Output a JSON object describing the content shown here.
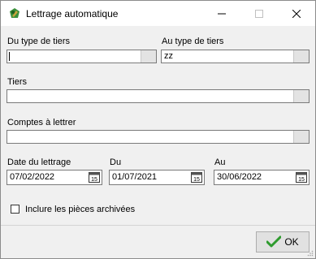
{
  "window": {
    "title": "Lettrage automatique",
    "controls": {
      "minimize": "minimize-icon",
      "maximize": "maximize-icon",
      "close": "close-icon"
    }
  },
  "form": {
    "du_type_tiers": {
      "label": "Du type de tiers",
      "value": ""
    },
    "au_type_tiers": {
      "label": "Au type de tiers",
      "value": "zz"
    },
    "tiers": {
      "label": "Tiers",
      "value": ""
    },
    "comptes": {
      "label": "Comptes à lettrer",
      "value": ""
    },
    "date_lettrage": {
      "label": "Date du lettrage",
      "value": "07/02/2022",
      "calendar_icon": "15"
    },
    "du": {
      "label": "Du",
      "value": "01/07/2021",
      "calendar_icon": "15"
    },
    "au": {
      "label": "Au",
      "value": "30/06/2022",
      "calendar_icon": "15"
    },
    "archives": {
      "label": "Inclure les pièces archivées",
      "checked": false
    }
  },
  "footer": {
    "ok_label": "OK",
    "ok_icon": "checkmark-icon"
  },
  "colors": {
    "check_green": "#2e9b2e",
    "field_border": "#7a7a7a",
    "dialog_bg": "#f0f0f0"
  }
}
